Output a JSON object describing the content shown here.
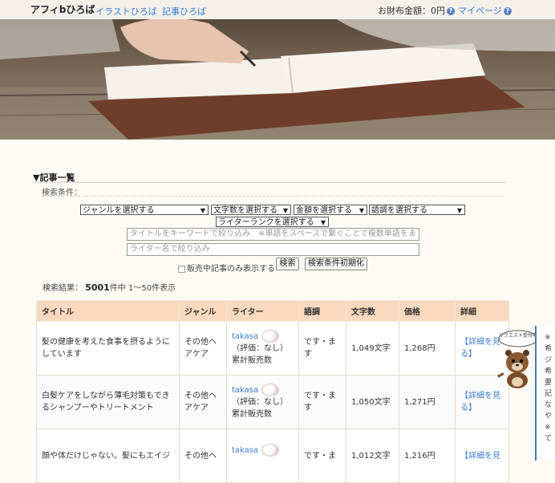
{
  "header": {
    "logo": "アフィbひろば",
    "nav": [
      "イラストひろば",
      "記事ひろば"
    ],
    "wallet": "お財布金額：0円",
    "mypage": "マイページ",
    "help": "?"
  },
  "section": {
    "title": "▼記事一覧",
    "conditions_label": "検索条件："
  },
  "filters": {
    "genre": "ジャンルを選択する",
    "length": "文字数を選択する",
    "price": "金額を選択する",
    "tone": "語調を選択する",
    "rank": "ライターランクを選択する",
    "keyword_placeholder": "タイトルをキーワードで絞り込み　※単語をスペースで繋ぐことで複数単語をま",
    "writer_placeholder": "ライター名で絞り込み",
    "onsale_label": "販売中記事のみ表示する",
    "search_button": "検索",
    "reset_button": "検索条件初期化"
  },
  "results": {
    "label": "検索結果：",
    "count": "5001",
    "suffix": "件中 1〜50件表示"
  },
  "table": {
    "headers": [
      "タイトル",
      "ジャンル",
      "ライター",
      "語調",
      "文字数",
      "価格",
      "詳細"
    ],
    "rows": [
      {
        "title": "髪の健康を考えた食事を摂るようにしています",
        "genre": "その他ヘアケア",
        "writer": "takasa",
        "rating": "（評価：なし）",
        "sales": "累計販売数",
        "tone": "です・ます",
        "chars": "1,049文字",
        "price": "1,268円",
        "detail": "【詳細を見る】"
      },
      {
        "title": "白髪ケアをしながら薄毛対策もできるシャンプーやトリートメント",
        "genre": "その他ヘアケア",
        "writer": "takasa",
        "rating": "（評価：なし）",
        "sales": "累計販売数",
        "tone": "です・ます",
        "chars": "1,050文字",
        "price": "1,271円",
        "detail": "【詳細を見る】"
      },
      {
        "title": "顔や体だけじゃない。髪にもエイジ",
        "genre": "その他ヘ",
        "writer": "takasa",
        "rating": "",
        "sales": "",
        "tone": "です・ま",
        "chars": "1,012文字",
        "price": "1,216円",
        "detail": "【詳細を見"
      }
    ]
  },
  "mascot": {
    "sign": "リクエスト受付中"
  },
  "sidepanel": {
    "lines": [
      "※",
      "希",
      "ジ",
      "希",
      "要",
      "",
      "記",
      "な",
      "や",
      "",
      "※",
      "て"
    ]
  }
}
